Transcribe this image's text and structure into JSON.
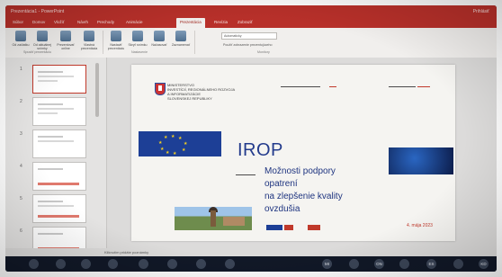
{
  "window": {
    "title_left": "Prezentácia1 - PowerPoint",
    "title_center": "",
    "user": "Prihlásiť"
  },
  "ribbon": {
    "tabs": [
      "Súbor",
      "Domov",
      "Vložiť",
      "Návrh",
      "Prechody",
      "Animácie",
      "Prezentácia",
      "Revízia",
      "Zobraziť"
    ],
    "active_tab_index": 6,
    "buttons": [
      {
        "label": "Od začiatku",
        "icon": "play-icon"
      },
      {
        "label": "Od aktuálnej snímky",
        "icon": "play-current-icon"
      },
      {
        "label": "Prezentovať online",
        "icon": "online-icon"
      },
      {
        "label": "Vlastná prezentácia",
        "icon": "custom-show-icon"
      },
      {
        "label": "Nastaviť prezentáciu",
        "icon": "setup-icon"
      },
      {
        "label": "Skryť snímku",
        "icon": "hide-slide-icon"
      },
      {
        "label": "Načasovať",
        "icon": "timing-icon"
      },
      {
        "label": "Zaznamenať",
        "icon": "record-icon"
      }
    ],
    "group_start": "Spustiť prezentáciu",
    "group_setup": "Nastavenie",
    "group_monitors": "Monitory",
    "monitor_field": "Automaticky",
    "presenter_view": "Použiť zobrazenie prezentujúceho"
  },
  "thumbnails": {
    "numbers": [
      "1",
      "2",
      "3",
      "4",
      "5",
      "6"
    ],
    "selected_index": 0
  },
  "slide": {
    "ministry_lines": [
      "MINISTERSTVO",
      "INVESTÍCIÍ, REGIONÁLNEHO ROZVOJA",
      "A INFORMATIZÁCIE",
      "SLOVENSKEJ REPUBLIKY"
    ],
    "acronym": "IROP",
    "title_lines": [
      "Možnosti podpory",
      "opatrení",
      "na zlepšenie kvality",
      "ovzdušia"
    ],
    "date": "4. mája 2023"
  },
  "statusbar": {
    "text": "Kliknutím pridáte poznámky"
  },
  "taskbar": {
    "icons": [
      "",
      "",
      "",
      "",
      "",
      "",
      "",
      "",
      "MI",
      "",
      "ON",
      "",
      "ES",
      "",
      "KD"
    ]
  },
  "colors": {
    "ribbon_red": "#b8302a",
    "title_blue": "#233b8c",
    "date_red": "#c0392b",
    "eu_blue": "#1d3f96"
  }
}
